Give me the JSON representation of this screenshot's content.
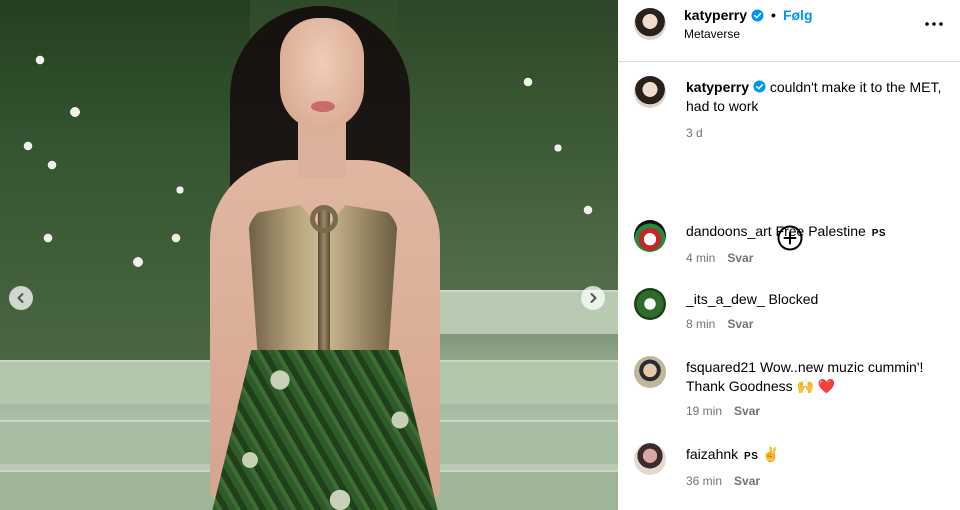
{
  "post": {
    "image_alt": "Photo",
    "nav": {
      "prev_label": "‹",
      "next_label": "›"
    }
  },
  "header": {
    "username": "katyperry",
    "separator": "•",
    "follow_label": "Følg",
    "location": "Metaverse"
  },
  "caption": {
    "username": "katyperry",
    "text": "couldn't make it to the MET, had to work",
    "time": "3 d"
  },
  "comments": [
    {
      "username": "dandoons_art",
      "text": "Free Palestine",
      "tag": "PS",
      "time": "4 min",
      "reply_label": "Svar"
    },
    {
      "username": "_its_a_dew_",
      "text": "Blocked",
      "tag": "",
      "time": "8 min",
      "reply_label": "Svar"
    },
    {
      "username": "fsquared21",
      "text": "Wow..new muzic cummin'! Thank Goodness 🙌 ❤️",
      "tag": "",
      "time": "19 min",
      "reply_label": "Svar"
    },
    {
      "username": "faizahnk",
      "text": "✌️",
      "tag": "PS",
      "time": "36 min",
      "reply_label": "Svar"
    }
  ],
  "colors": {
    "link": "#0095f6",
    "muted": "#737373",
    "divider": "#dbdbdb",
    "verified": "#0095f6"
  },
  "icons": [
    "chevron-left-icon",
    "chevron-right-icon",
    "verified-badge-icon",
    "more-options-icon",
    "load-more-plus-icon"
  ]
}
